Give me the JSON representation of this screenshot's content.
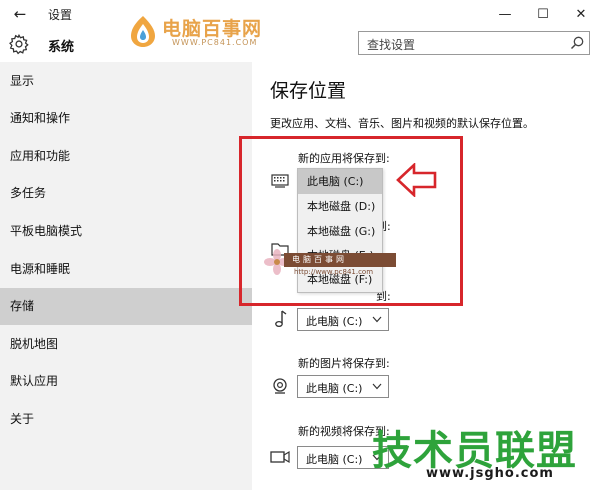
{
  "window": {
    "back_glyph": "←",
    "title": "设置",
    "minimize_glyph": "—",
    "maximize_glyph": "☐",
    "close_glyph": "✕"
  },
  "header": {
    "app_name": "系统",
    "search_placeholder": "查找设置"
  },
  "watermarks": {
    "top_title": "电脑百事网",
    "top_url": "WWW.PC841.COM",
    "mid_title": "电脑百事网",
    "mid_url": "http://www.pc841.com",
    "bottom_title": "技术员联盟",
    "bottom_url": "www.jsgho.com"
  },
  "sidebar": {
    "items": [
      {
        "label": "显示"
      },
      {
        "label": "通知和操作"
      },
      {
        "label": "应用和功能"
      },
      {
        "label": "多任务"
      },
      {
        "label": "平板电脑模式"
      },
      {
        "label": "电源和睡眠"
      },
      {
        "label": "存储"
      },
      {
        "label": "脱机地图"
      },
      {
        "label": "默认应用"
      },
      {
        "label": "关于"
      }
    ],
    "active_index": 6
  },
  "main": {
    "title": "保存位置",
    "description": "更改应用、文档、音乐、图片和视频的默认保存位置。",
    "groups": [
      {
        "label": "新的应用将保存到:",
        "value": "此电脑 (C:)",
        "icon": "monitor-icon"
      },
      {
        "label": "到:",
        "value": "此电脑 (C:)",
        "icon": "folder-icon"
      },
      {
        "label": "到:",
        "value": "此电脑 (C:)",
        "icon": "music-note-icon"
      },
      {
        "label": "新的图片将保存到:",
        "value": "此电脑 (C:)",
        "icon": "camera-icon"
      },
      {
        "label": "新的视频将保存到:",
        "value": "此电脑 (C:)",
        "icon": "video-icon"
      }
    ],
    "open_dropdown": {
      "options": [
        "此电脑 (C:)",
        "本地磁盘 (D:)",
        "本地磁盘 (G:)",
        "本地磁盘 (E:)",
        "本地磁盘 (F:)"
      ],
      "selected_index": 0
    }
  },
  "colors": {
    "sidebar_bg": "#f2f2f2",
    "sidebar_active": "#cfcfcf",
    "highlight_red": "#d7262b",
    "watermark_green": "#2ea33b",
    "watermark_orange": "#e8a34a"
  }
}
